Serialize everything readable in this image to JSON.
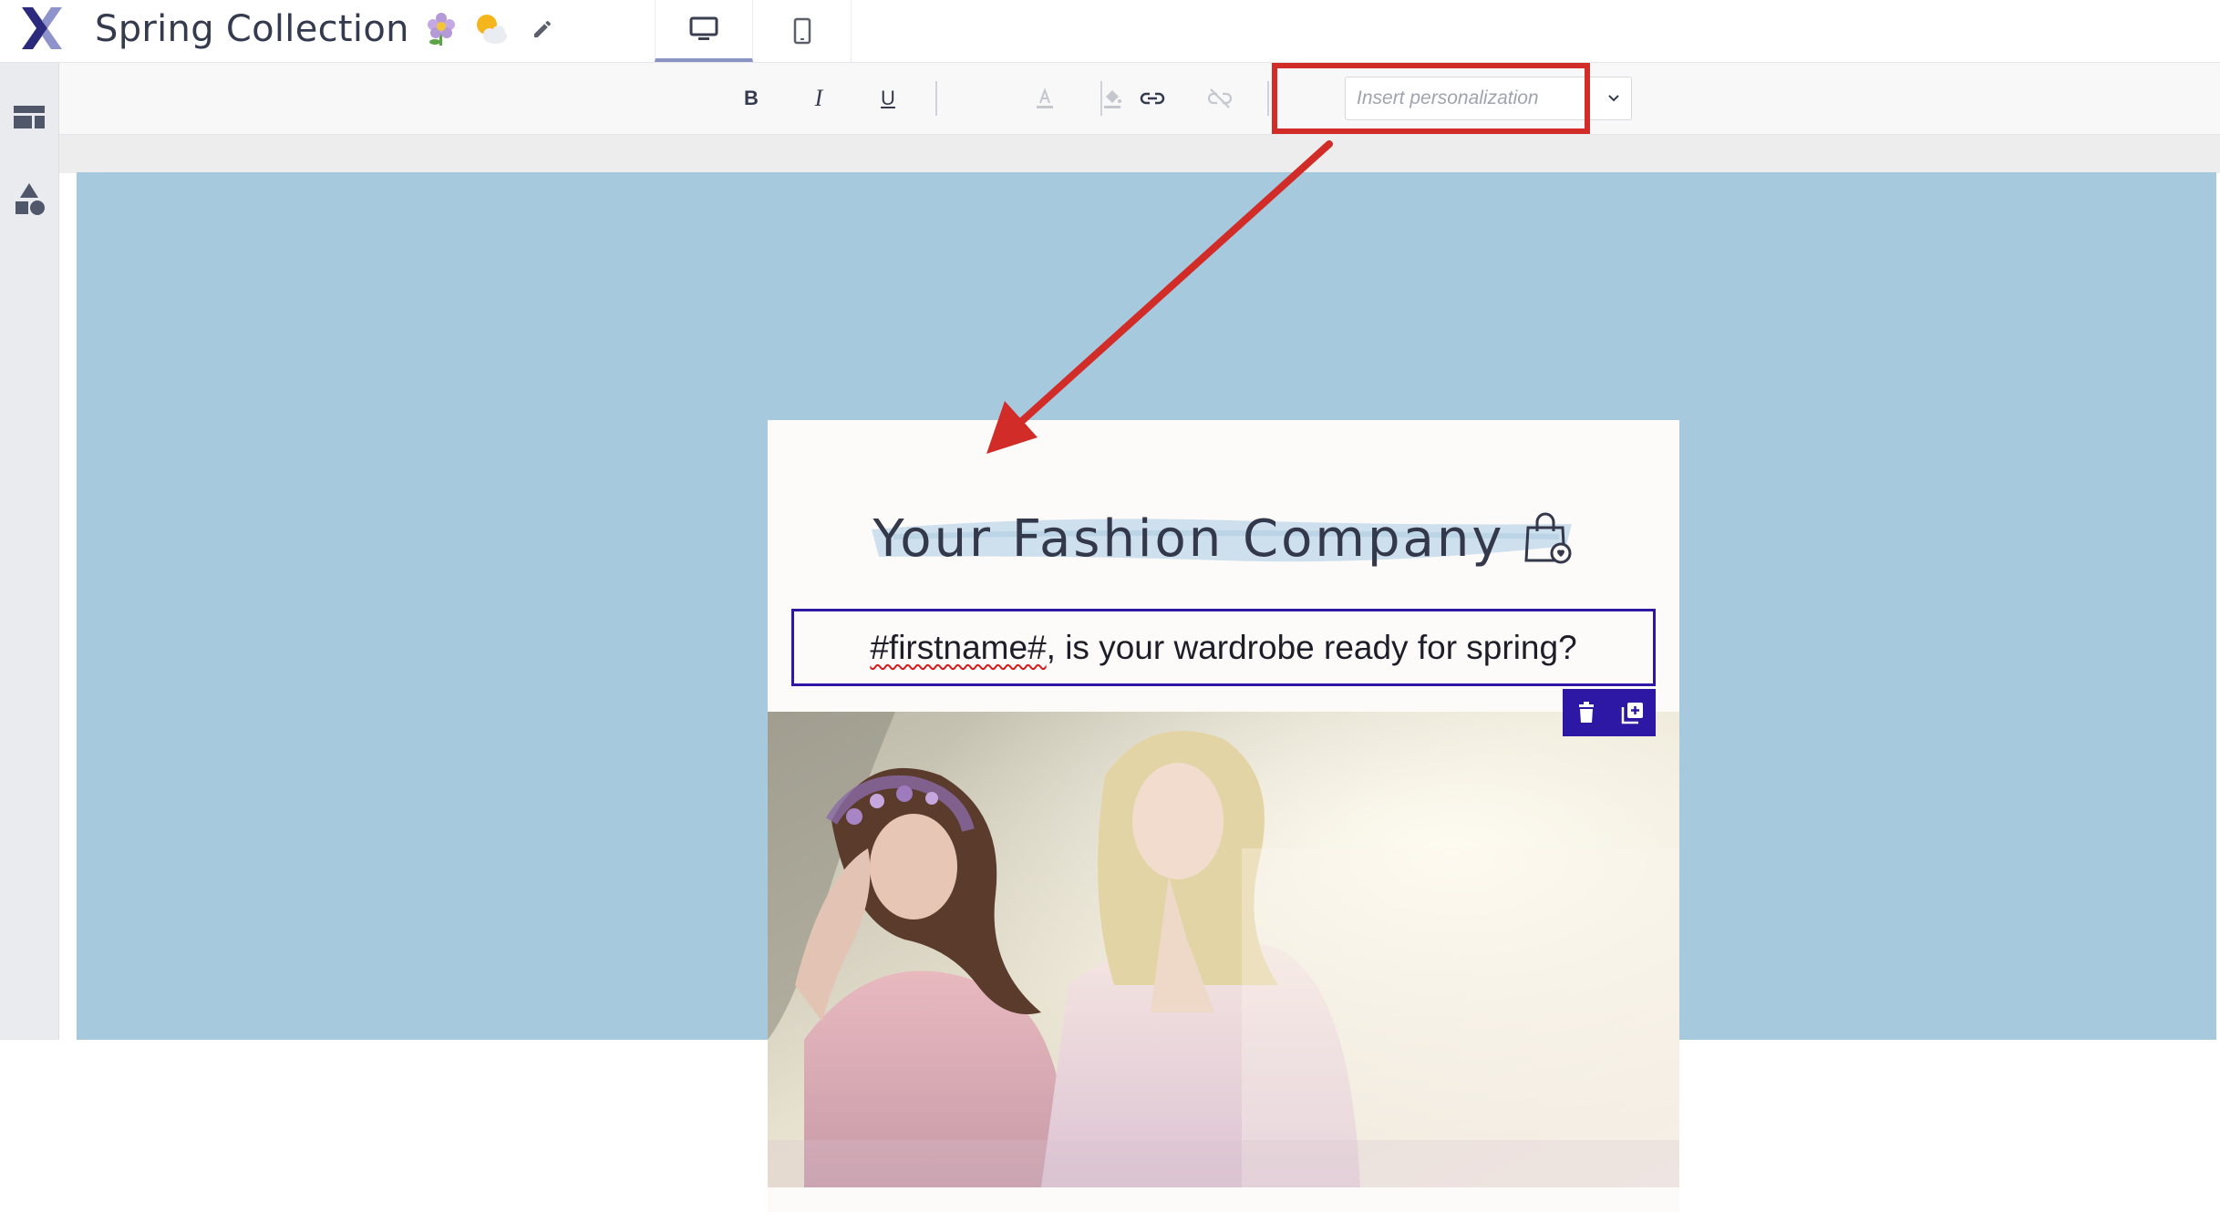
{
  "header": {
    "title": "Spring Collection",
    "emojis": [
      "flower-emoji",
      "sun-behind-cloud-emoji"
    ],
    "edit_icon": "pencil-icon",
    "views": [
      {
        "name": "desktop-icon",
        "active": true
      },
      {
        "name": "mobile-icon",
        "active": false
      }
    ]
  },
  "sidebar": {
    "items": [
      {
        "icon": "layout-rows-icon"
      },
      {
        "icon": "shapes-icon"
      }
    ]
  },
  "toolbar": {
    "bold": "B",
    "italic": "I",
    "underline": "U",
    "text_color_icon": "text-color-icon",
    "fill_color_icon": "paint-bucket-icon",
    "link_icon": "link-icon",
    "unlink_icon": "unlink-icon",
    "personalization_placeholder": "Insert personalization",
    "dropdown_icon": "chevron-down-icon"
  },
  "email": {
    "brand": "Your Fashion Company",
    "brand_icon": "shopping-bag-heart-icon",
    "greeting_token": "#firstname#",
    "greeting_rest": ", is your wardrobe ready for spring?",
    "block_actions": [
      "trash-icon",
      "duplicate-icon"
    ],
    "hero_image": "two-women-in-pastel-spring-dresses-photo"
  },
  "annotation": {
    "color": "#d12c28",
    "highlight": "personalization-dropdown-highlight",
    "arrow": "arrow-to-greeting"
  },
  "colors": {
    "canvas_bg": "#a7c9de",
    "selection": "#2d18a6",
    "brand_text": "#33384a",
    "logo_dark": "#2b2a7d",
    "logo_light": "#8f93cc"
  }
}
